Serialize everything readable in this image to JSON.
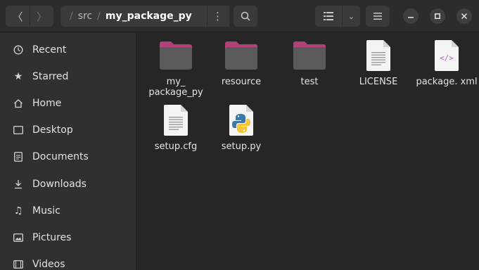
{
  "header": {
    "back_icon": "chevron-left-icon",
    "forward_icon": "chevron-right-icon",
    "path": {
      "sep1": "/",
      "segment_src": "src",
      "sep2": "/",
      "segment_current": "my_package_py"
    },
    "path_menu_icon": "vertical-dots-icon",
    "search_icon": "search-icon",
    "view_icon": "list-view-icon",
    "view_options_icon": "chevron-down-icon",
    "menu_icon": "hamburger-menu-icon",
    "window_controls": [
      "minimize",
      "maximize",
      "close"
    ]
  },
  "sidebar": {
    "items": [
      {
        "label": "Recent",
        "icon": "clock-icon"
      },
      {
        "label": "Starred",
        "icon": "star-icon"
      },
      {
        "label": "Home",
        "icon": "home-icon"
      },
      {
        "label": "Desktop",
        "icon": "desktop-icon"
      },
      {
        "label": "Documents",
        "icon": "document-icon"
      },
      {
        "label": "Downloads",
        "icon": "download-icon"
      },
      {
        "label": "Music",
        "icon": "music-icon"
      },
      {
        "label": "Pictures",
        "icon": "picture-icon"
      },
      {
        "label": "Videos",
        "icon": "video-icon"
      }
    ]
  },
  "files": [
    {
      "name": "my_ package_py",
      "type": "folder"
    },
    {
      "name": "resource",
      "type": "folder"
    },
    {
      "name": "test",
      "type": "folder"
    },
    {
      "name": "LICENSE",
      "type": "text-file"
    },
    {
      "name": "package. xml",
      "type": "xml-file"
    },
    {
      "name": "setup.cfg",
      "type": "text-file"
    },
    {
      "name": "setup.py",
      "type": "python-file"
    }
  ],
  "colors": {
    "folder_body": "#5a5a5a",
    "folder_tab": "#b3407a",
    "xml_accent": "#c061cb",
    "python_blue": "#3b77a8",
    "python_yellow": "#f4c53a"
  }
}
